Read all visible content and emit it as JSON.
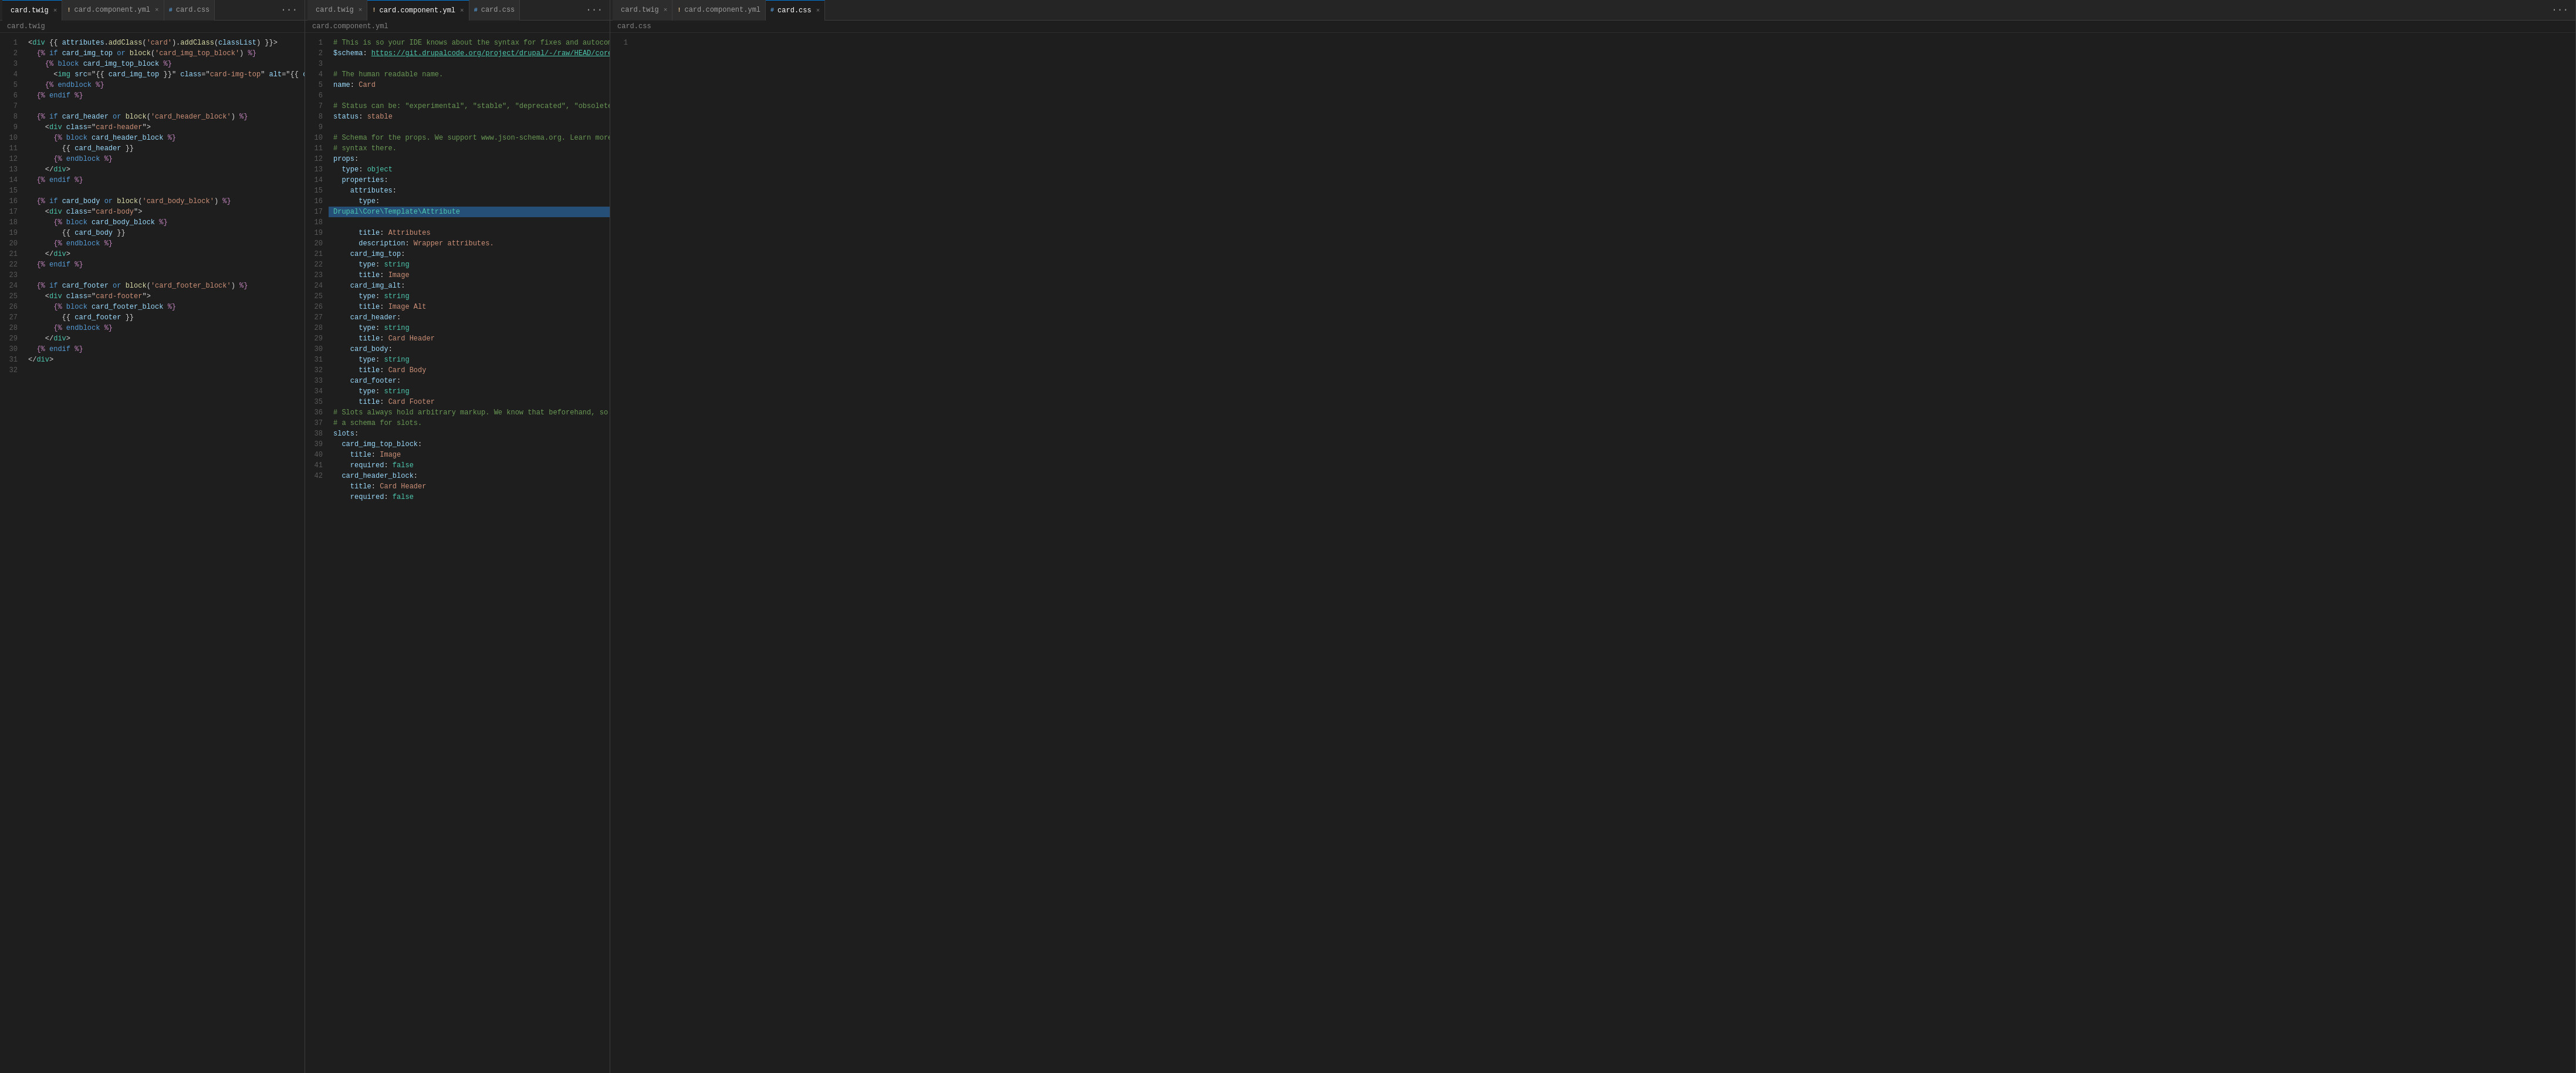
{
  "panes": [
    {
      "id": "pane-1",
      "tabs": [
        {
          "id": "tab-twig-1",
          "label": "card.twig",
          "type": "twig",
          "active": true,
          "modified": false
        },
        {
          "id": "tab-yaml-1",
          "label": "card.component.yml",
          "type": "yaml",
          "active": false,
          "modified": true
        },
        {
          "id": "tab-css-1",
          "label": "card.css",
          "type": "css",
          "active": false,
          "modified": false
        }
      ],
      "breadcrumb": "card.twig",
      "menu_icon": "···"
    },
    {
      "id": "pane-2",
      "tabs": [
        {
          "id": "tab-twig-2",
          "label": "card.twig",
          "type": "twig",
          "active": false,
          "modified": false
        },
        {
          "id": "tab-yaml-2",
          "label": "card.component.yml",
          "type": "yaml",
          "active": true,
          "modified": true
        },
        {
          "id": "tab-css-2",
          "label": "card.css",
          "type": "css",
          "active": false,
          "modified": false
        }
      ],
      "breadcrumb": "card.component.yml",
      "menu_icon": "···"
    },
    {
      "id": "pane-3",
      "tabs": [
        {
          "id": "tab-twig-3",
          "label": "card.twig",
          "type": "twig",
          "active": false,
          "modified": false
        },
        {
          "id": "tab-yaml-3",
          "label": "card.component.yml",
          "type": "yaml",
          "active": false,
          "modified": false
        },
        {
          "id": "tab-css-3",
          "label": "card.css",
          "type": "css",
          "active": true,
          "modified": false
        }
      ],
      "breadcrumb": "card.css",
      "menu_icon": "···"
    }
  ],
  "icons": {
    "close": "×",
    "menu": "···",
    "twig_prefix": "",
    "yaml_prefix": "!",
    "css_prefix": "#"
  }
}
